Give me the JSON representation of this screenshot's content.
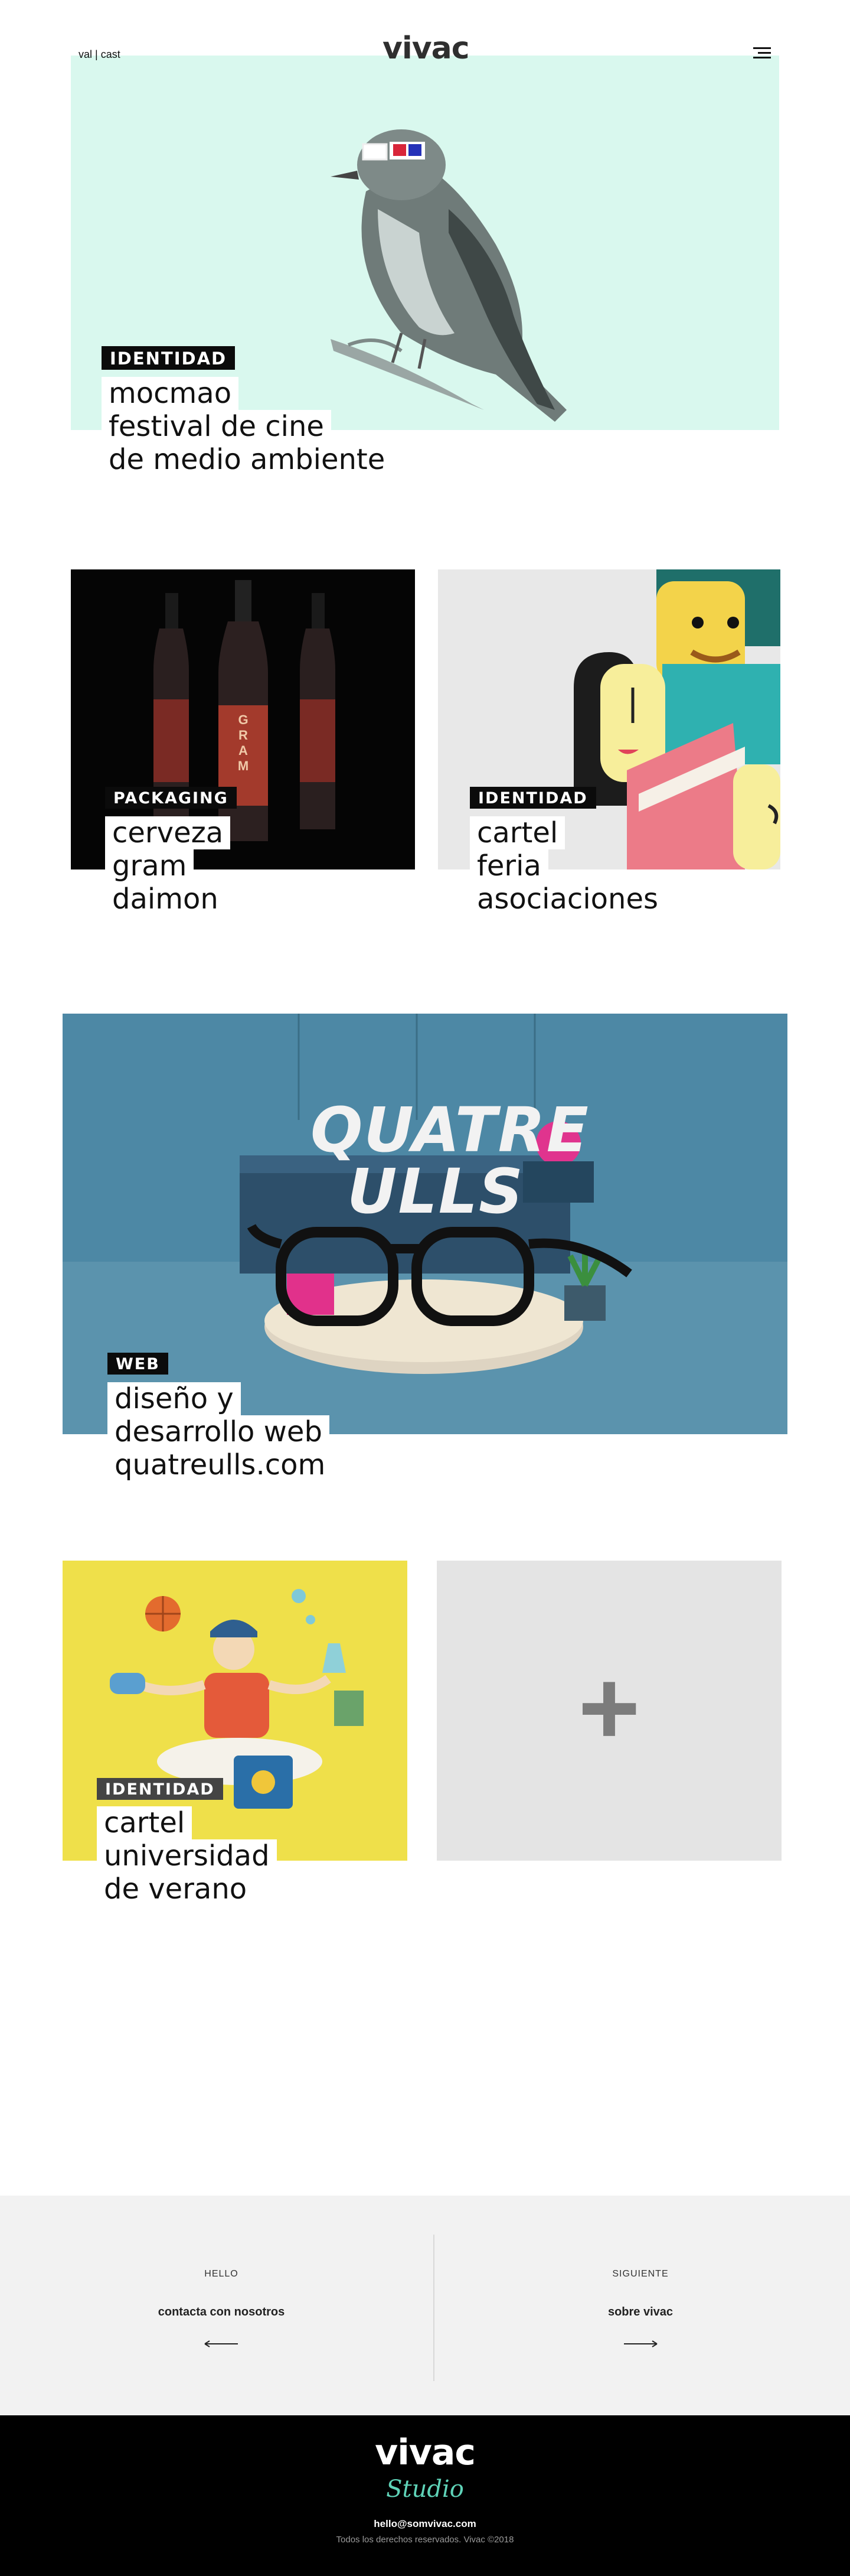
{
  "header": {
    "lang_val": "val",
    "lang_sep": "|",
    "lang_cast": "cast",
    "logo": "vivac"
  },
  "projects": [
    {
      "tag": "IDENTIDAD",
      "lines": [
        "mocmao",
        "festival de cine",
        "de medio ambiente"
      ]
    },
    {
      "tag": "PACKAGING",
      "lines": [
        "cerveza",
        "gram",
        "daimon"
      ],
      "bottle_text": "GRAM"
    },
    {
      "tag": "IDENTIDAD",
      "lines": [
        "cartel",
        "feria",
        "asociaciones"
      ]
    },
    {
      "tag": "WEB",
      "lines": [
        "diseño y",
        "desarrollo web",
        "quatreulls.com"
      ],
      "image_text_1": "QUATRE",
      "image_text_2": "ULLS"
    },
    {
      "tag": "IDENTIDAD",
      "lines": [
        "cartel",
        "universidad",
        "de verano"
      ]
    }
  ],
  "more": {
    "symbol": "+"
  },
  "footer_nav": {
    "left": {
      "small": "HELLO",
      "link": "contacta con nosotros"
    },
    "right": {
      "small": "SIGUIENTE",
      "link": "sobre vivac"
    }
  },
  "footer": {
    "logo": "vivac",
    "studio": "Studio",
    "email": "hello@somvivac.com",
    "rights": "Todos los derechos reservados. Vivac ©2018"
  },
  "colors": {
    "mint": "#d9f8ee",
    "beer_bg": "#050505",
    "cartel_bg": "#e8e8e8",
    "quatre_bg": "#4a86a3",
    "yellow": "#efe04a",
    "more_bg": "#e4e4e4",
    "footer_nav_bg": "#f2f2f2"
  }
}
